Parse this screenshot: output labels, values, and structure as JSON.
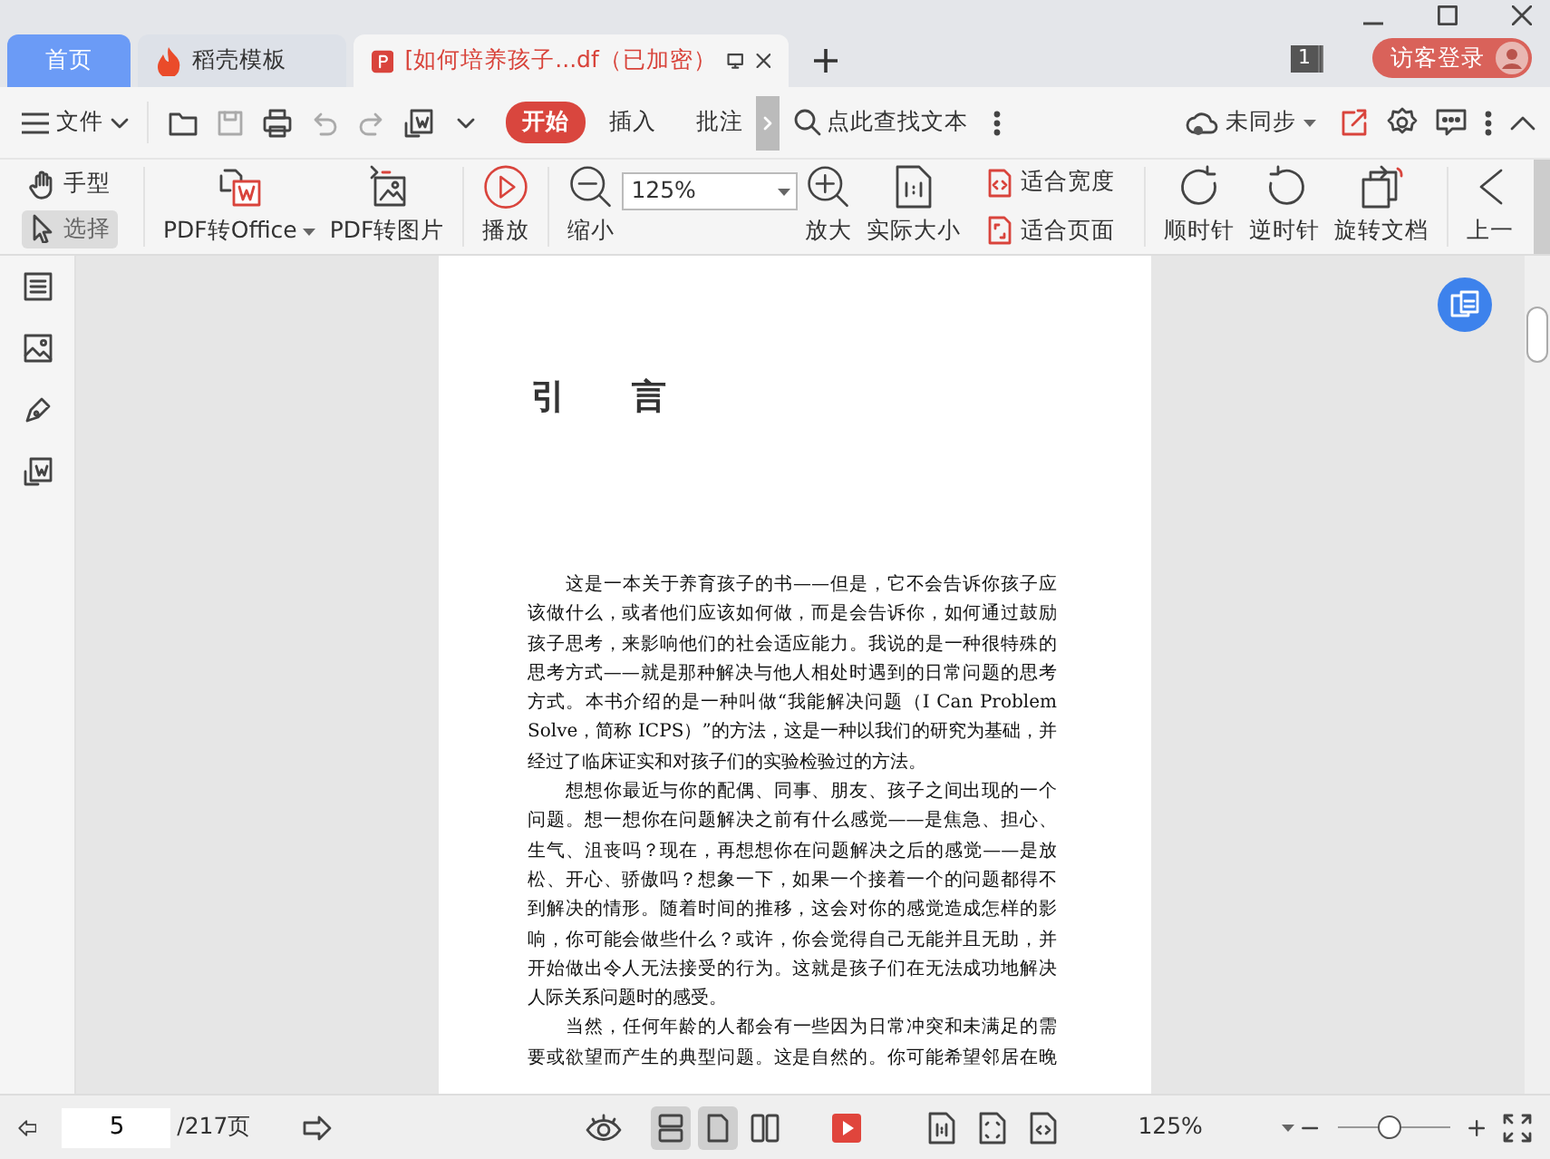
{
  "tabs": [
    {
      "label": "首页",
      "kind": "home",
      "selected": false
    },
    {
      "label": "稻壳模板",
      "kind": "template",
      "selected": false
    },
    {
      "label": "[如何培养孩子...df（已加密）",
      "kind": "document",
      "selected": true
    }
  ],
  "tab_count": "1",
  "login_button": "访客登录",
  "menu": {
    "file": "文件",
    "ribbon_tabs": [
      {
        "label": "开始",
        "selected": true
      },
      {
        "label": "插入",
        "selected": false
      },
      {
        "label": "批注",
        "selected": false
      }
    ],
    "search": {
      "placeholder": "点此查找文本"
    },
    "sync": "未同步"
  },
  "toolbar": {
    "tools": [
      {
        "label": "手型",
        "selected": false
      },
      {
        "label": "选择",
        "selected": true
      }
    ],
    "convert": [
      {
        "label": "PDF转Office",
        "dropdown": true
      },
      {
        "label": "PDF转图片",
        "dropdown": false
      }
    ],
    "play": "播放",
    "zoom_out": "缩小",
    "zoom_value": "125%",
    "zoom_in": "放大",
    "actual_size": "实际大小",
    "fit": [
      "适合宽度",
      "适合页面"
    ],
    "rotate": [
      "顺时针",
      "逆时针",
      "旋转文档"
    ],
    "previous": "上一"
  },
  "document": {
    "heading": "引 言",
    "paragraphs": [
      {
        "continues": false,
        "lines": [
          "这是一本关于养育孩子的书——但是，它不会告诉你孩子应",
          "该做什么，或者他们应该如何做，而是会告诉你，如何通过鼓励",
          "孩子思考，来影响他们的社会适应能力。我说的是一种很特殊的",
          "思考方式——就是那种解决与他人相处时遇到的日常问题的思考",
          "方式。本书介绍的是一种叫做“我能解决问题（I Can Problem",
          "Solve，简称 ICPS）”的方法，这是一种以我们的研究为基础，并",
          "经过了临床证实和对孩子们的实验检验过的方法。"
        ]
      },
      {
        "continues": false,
        "lines": [
          "想想你最近与你的配偶、同事、朋友、孩子之间出现的一个",
          "问题。想一想你在问题解决之前有什么感觉——是焦急、担心、",
          "生气、沮丧吗？现在，再想想你在问题解决之后的感觉——是放",
          "松、开心、骄傲吗？想象一下，如果一个接着一个的问题都得不",
          "到解决的情形。随着时间的推移，这会对你的感觉造成怎样的影",
          "响，你可能会做些什么？或许，你会觉得自己无能并且无助，并",
          "开始做出令人无法接受的行为。这就是孩子们在无法成功地解决",
          "人际关系问题时的感受。"
        ]
      },
      {
        "continues": true,
        "lines": [
          "当然，任何年龄的人都会有一些因为日常冲突和未满足的需",
          "要或欲望而产生的典型问题。这是自然的。你可能希望邻居在晚"
        ]
      }
    ]
  },
  "status_bar": {
    "page": "5",
    "page_total": "/217页",
    "view_modes": [
      {
        "selected": true
      },
      {
        "selected": true
      },
      {
        "selected": false
      }
    ],
    "zoom": "125%",
    "zoom_slider": {
      "level": 0.45
    }
  }
}
